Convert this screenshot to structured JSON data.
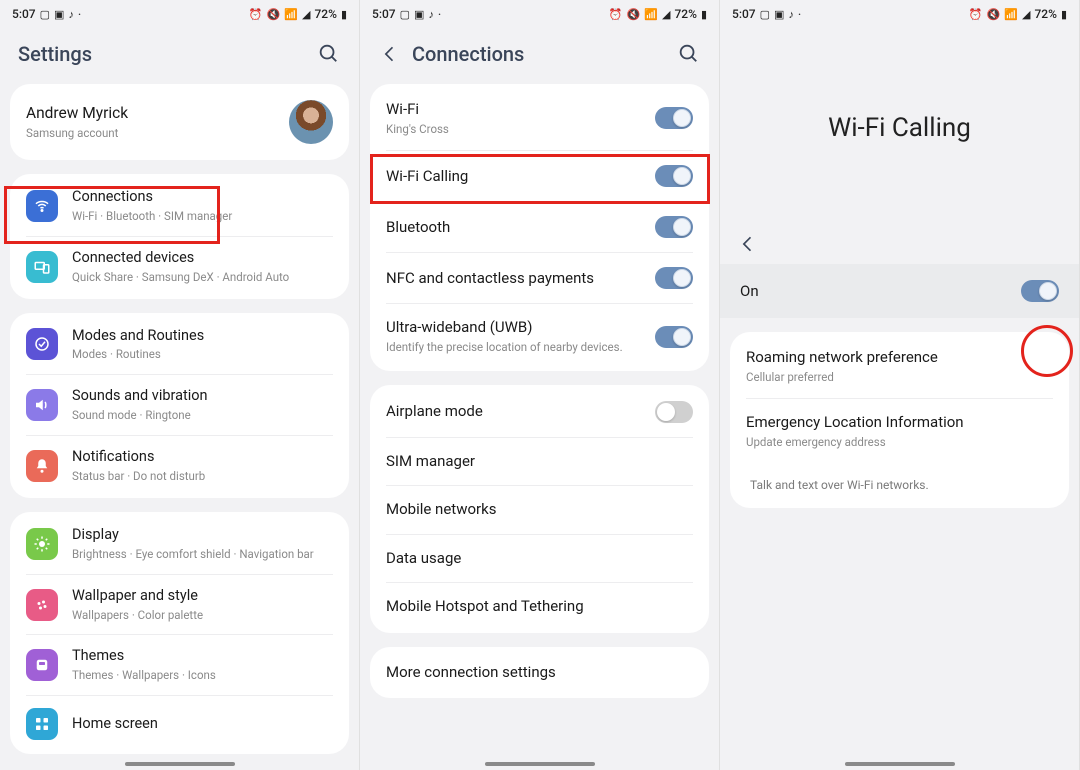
{
  "status": {
    "time": "5:07",
    "battery": "72%"
  },
  "panel1": {
    "title": "Settings",
    "profile": {
      "name": "Andrew Myrick",
      "sub": "Samsung account"
    },
    "group1": [
      {
        "icon": "wifi",
        "color": "#3b6fd6",
        "label": "Connections",
        "sub": "Wi-Fi  ·  Bluetooth  ·  SIM manager"
      },
      {
        "icon": "link",
        "color": "#38bcd1",
        "label": "Connected devices",
        "sub": "Quick Share  ·  Samsung DeX  ·  Android Auto"
      }
    ],
    "group2": [
      {
        "icon": "check",
        "color": "#5c53d6",
        "label": "Modes and Routines",
        "sub": "Modes  ·  Routines"
      },
      {
        "icon": "sound",
        "color": "#8b7ae8",
        "label": "Sounds and vibration",
        "sub": "Sound mode  ·  Ringtone"
      },
      {
        "icon": "bell",
        "color": "#ea6a59",
        "label": "Notifications",
        "sub": "Status bar  ·  Do not disturb"
      }
    ],
    "group3": [
      {
        "icon": "sun",
        "color": "#79c94a",
        "label": "Display",
        "sub": "Brightness  ·  Eye comfort shield  ·  Navigation bar"
      },
      {
        "icon": "flower",
        "color": "#e85b86",
        "label": "Wallpaper and style",
        "sub": "Wallpapers  ·  Color palette"
      },
      {
        "icon": "theme",
        "color": "#a060d6",
        "label": "Themes",
        "sub": "Themes  ·  Wallpapers  ·  Icons"
      },
      {
        "icon": "grid",
        "color": "#2fa7d6",
        "label": "Home screen",
        "sub": ""
      }
    ]
  },
  "panel2": {
    "title": "Connections",
    "group1": [
      {
        "label": "Wi-Fi",
        "sub": "King's Cross",
        "toggle": true
      },
      {
        "label": "Wi-Fi Calling",
        "sub": "",
        "toggle": true
      },
      {
        "label": "Bluetooth",
        "sub": "",
        "toggle": true
      },
      {
        "label": "NFC and contactless payments",
        "sub": "",
        "toggle": true
      },
      {
        "label": "Ultra-wideband (UWB)",
        "sub": "Identify the precise location of nearby devices.",
        "toggle": true
      }
    ],
    "group2": [
      {
        "label": "Airplane mode",
        "toggle": false
      },
      {
        "label": "SIM manager"
      },
      {
        "label": "Mobile networks"
      },
      {
        "label": "Data usage"
      },
      {
        "label": "Mobile Hotspot and Tethering"
      }
    ],
    "group3": [
      {
        "label": "More connection settings"
      }
    ]
  },
  "panel3": {
    "title": "Wi-Fi Calling",
    "toggle_label": "On",
    "items": [
      {
        "label": "Roaming network preference",
        "sub": "Cellular preferred"
      },
      {
        "label": "Emergency Location Information",
        "sub": "Update emergency address"
      }
    ],
    "hint": "Talk and text over Wi-Fi networks."
  }
}
